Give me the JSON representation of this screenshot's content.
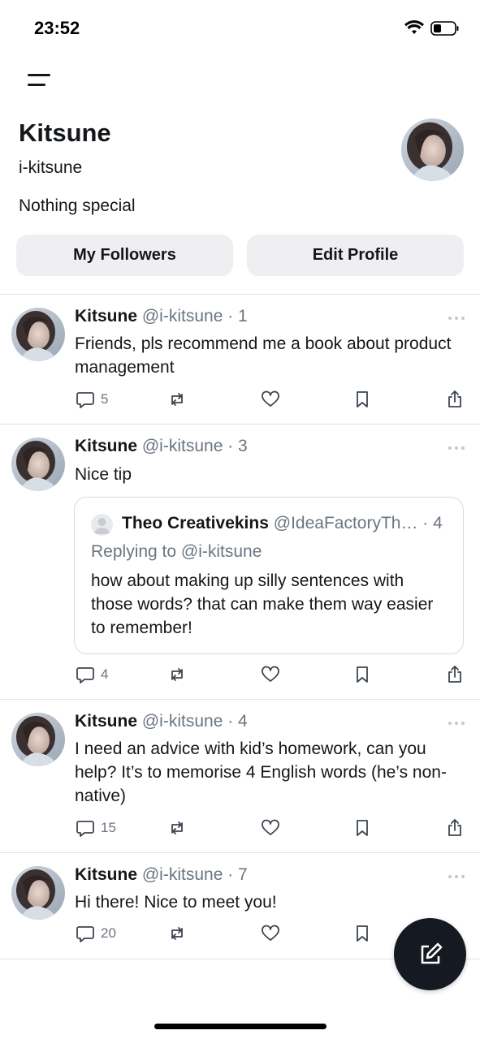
{
  "status_bar": {
    "time": "23:52",
    "icons": [
      "wifi-icon",
      "battery-icon"
    ]
  },
  "header": {
    "menu_icon": "menu-icon"
  },
  "profile": {
    "name": "Kitsune",
    "handle": "i-kitsune",
    "bio": "Nothing special",
    "buttons": {
      "followers": "My Followers",
      "edit": "Edit Profile"
    }
  },
  "posts": [
    {
      "name": "Kitsune",
      "meta": "@i-kitsune · 1",
      "text": "Friends, pls recommend me a book about product management",
      "replies": "5"
    },
    {
      "name": "Kitsune",
      "meta": "@i-kitsune · 3",
      "text": "Nice tip",
      "replies": "4",
      "quote": {
        "name": "Theo Creativekins",
        "meta": "@IdeaFactoryTh… · 4",
        "replying_to": "Replying to @i-kitsune",
        "text": "how about making up silly sentences with those words? that can make them way easier to remember!"
      }
    },
    {
      "name": "Kitsune",
      "meta": "@i-kitsune · 4",
      "text": "I need an advice with kid’s homework, can you help? It’s to memorise 4 English words (he’s non-native)",
      "replies": "15"
    },
    {
      "name": "Kitsune",
      "meta": "@i-kitsune · 7",
      "text": "Hi there! Nice to meet you!",
      "replies": "20"
    }
  ],
  "fab": {
    "icon": "compose-icon"
  },
  "colors": {
    "text": "#14171a",
    "muted": "#6b7580",
    "button_bg": "#efeff1",
    "fab_bg": "#141922",
    "divider": "#e1e3e6"
  }
}
